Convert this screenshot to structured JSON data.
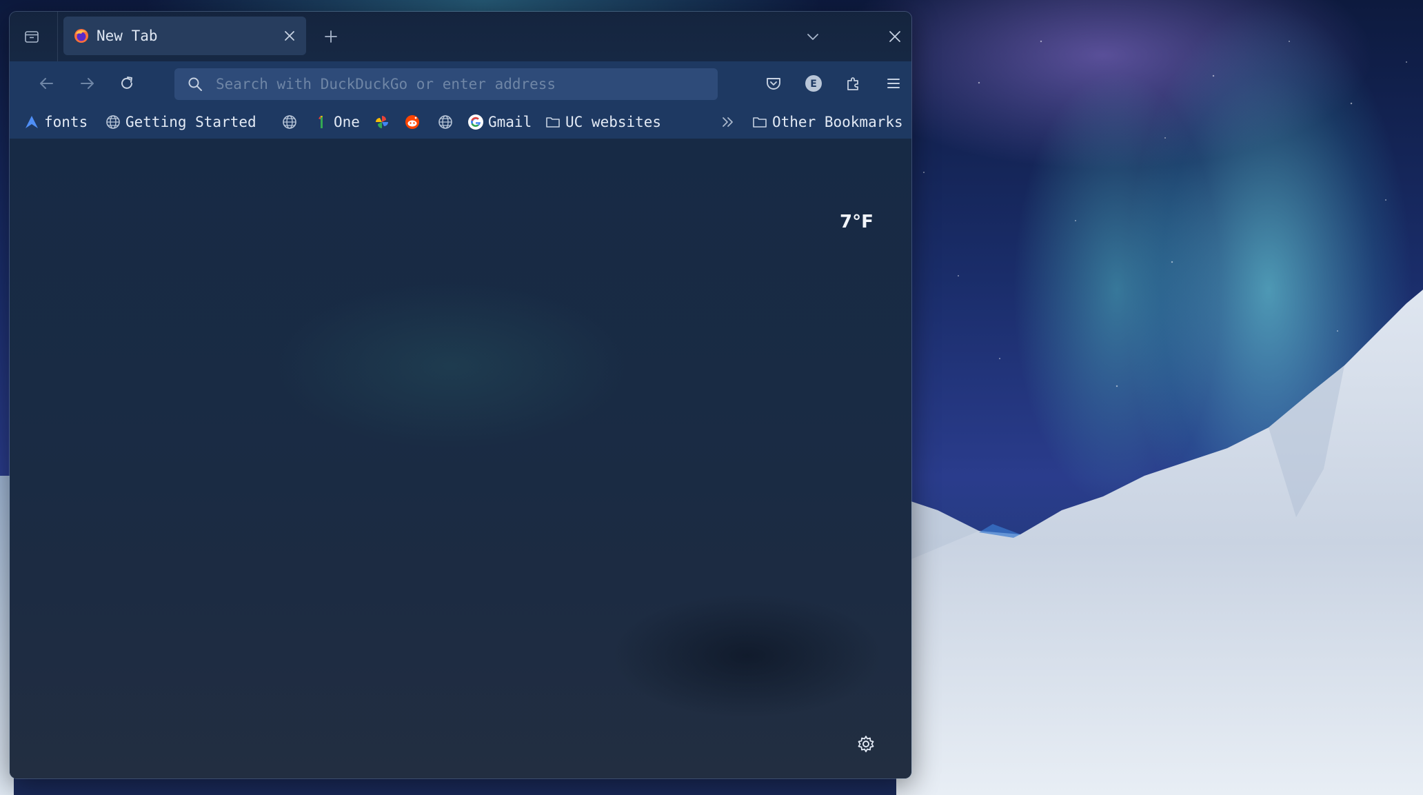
{
  "tab": {
    "title": "New Tab",
    "favicon": "firefox-icon"
  },
  "urlbar": {
    "placeholder": "Search with DuckDuckGo or enter address",
    "value": ""
  },
  "toolbar": {
    "back": "back-arrow-icon",
    "forward": "forward-arrow-icon",
    "reload": "reload-icon",
    "pocket": "pocket-icon",
    "account_initial": "E",
    "extensions": "puzzle-icon",
    "menu": "hamburger-menu-icon"
  },
  "bookmarks": {
    "items": [
      {
        "label": "fonts",
        "icon": "fonts-logo-icon"
      },
      {
        "label": "Getting Started",
        "icon": "globe-icon"
      },
      {
        "label": "",
        "icon": "globe-icon"
      },
      {
        "label": "One",
        "icon": "one-logo-icon"
      },
      {
        "label": "",
        "icon": "pinwheel-icon"
      },
      {
        "label": "",
        "icon": "reddit-icon"
      },
      {
        "label": "",
        "icon": "globe-icon"
      },
      {
        "label": "Gmail",
        "icon": "google-icon"
      },
      {
        "label": "UC websites",
        "icon": "folder-icon"
      }
    ],
    "overflow_icon": "chevrons-right-icon",
    "other": {
      "label": "Other Bookmarks",
      "icon": "folder-icon"
    }
  },
  "newtab": {
    "weather": "7°F",
    "settings_icon": "gear-icon"
  },
  "colors": {
    "window_bg": "#1c2a40",
    "toolbar_bg": "#1e3a64",
    "text": "#e3eaf5"
  }
}
